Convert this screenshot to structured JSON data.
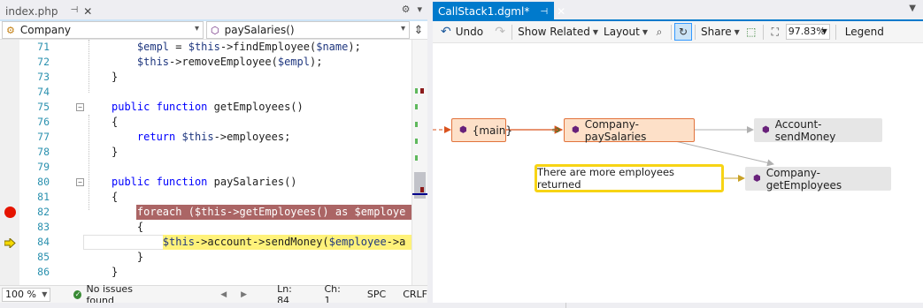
{
  "editor": {
    "tab": {
      "title": "index.php",
      "pin": "⊣",
      "close": "✕"
    },
    "tab_icons": {
      "settings": "⚙",
      "dropdown": "▾"
    },
    "nav": {
      "class_value": "Company",
      "method_value": "paySalaries()",
      "dropdown_glyph": "▾",
      "split_glyph": "⇕"
    },
    "lines": [
      {
        "num": "71",
        "code": "    $empl = $this->findEmployee($name);"
      },
      {
        "num": "72",
        "code": "    $this->removeEmployee($empl);"
      },
      {
        "num": "73",
        "code": "}"
      },
      {
        "num": "74",
        "code": ""
      },
      {
        "num": "75",
        "code": "public function getEmployees()"
      },
      {
        "num": "76",
        "code": "{"
      },
      {
        "num": "77",
        "code": "    return $this->employees;"
      },
      {
        "num": "78",
        "code": "}"
      },
      {
        "num": "79",
        "code": ""
      },
      {
        "num": "80",
        "code": "public function paySalaries()"
      },
      {
        "num": "81",
        "code": "{"
      },
      {
        "num": "82",
        "code": "    foreach ($this->getEmployees() as $employe"
      },
      {
        "num": "83",
        "code": "    {"
      },
      {
        "num": "84",
        "code": "        $this->account->sendMoney($employee->a"
      },
      {
        "num": "85",
        "code": "    }"
      },
      {
        "num": "86",
        "code": "}"
      }
    ],
    "breakpoint_line": "82",
    "current_line": "84",
    "status": {
      "zoom": "100 %",
      "issues": "No issues found",
      "ln": "Ln: 84",
      "ch": "Ch: 1",
      "spc": "SPC",
      "crlf": "CRLF"
    }
  },
  "diagram": {
    "tab": {
      "title": "CallStack1.dgml*",
      "pin": "⊣",
      "close": "✕"
    },
    "toolbar": {
      "undo": "Undo",
      "show_related": "Show Related",
      "layout": "Layout",
      "share": "Share",
      "zoom": "97.83%",
      "legend": "Legend"
    },
    "nodes": {
      "main": "{main}",
      "pay_salaries": "Company-paySalaries",
      "send_money": "Account-sendMoney",
      "get_employees": "Company-getEmployees"
    },
    "comment": "There are more employees returned",
    "colors": {
      "accent": "#007acc",
      "node_orange_fill": "#fde0c8",
      "node_orange_border": "#e2733c",
      "node_gray": "#e6e6e6",
      "callout_border": "#f7d414",
      "breakpoint": "#e51400",
      "breakpoint_line_bg": "#ab6565",
      "current_line_bg": "#fff27a"
    }
  }
}
